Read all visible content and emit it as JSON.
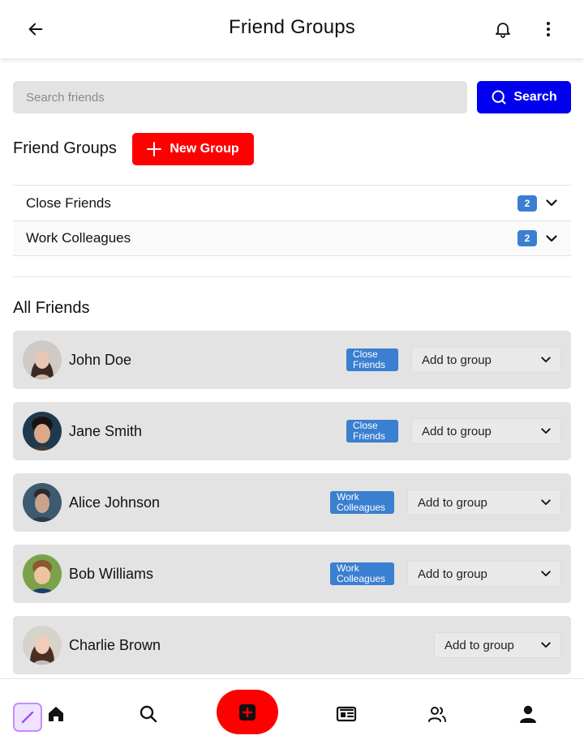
{
  "header": {
    "title": "Friend Groups"
  },
  "search": {
    "placeholder": "Search friends",
    "button_label": "Search"
  },
  "friend_groups": {
    "heading": "Friend Groups",
    "new_group_label": "New Group",
    "items": [
      {
        "name": "Close Friends",
        "count": "2"
      },
      {
        "name": "Work Colleagues",
        "count": "2"
      }
    ]
  },
  "all_friends": {
    "heading": "All Friends",
    "select_label": "Add to group",
    "items": [
      {
        "name": "John Doe",
        "badge_line1": "Close",
        "badge_line2": "Friends"
      },
      {
        "name": "Jane Smith",
        "badge_line1": "Close",
        "badge_line2": "Friends"
      },
      {
        "name": "Alice Johnson",
        "badge_line1": "Work",
        "badge_line2": "Colleagues"
      },
      {
        "name": "Bob Williams",
        "badge_line1": "Work",
        "badge_line2": "Colleagues"
      },
      {
        "name": "Charlie Brown",
        "badge_line1": "",
        "badge_line2": ""
      }
    ]
  },
  "bottom_nav": {
    "items": [
      "home-icon",
      "search-icon",
      "add-icon",
      "news-icon",
      "friends-icon",
      "profile-icon"
    ]
  },
  "colors": {
    "primary_blue": "#0000ee",
    "accent_red": "#ff0000",
    "badge_blue": "#3a7fd0",
    "card_gray": "#e3e3e3"
  }
}
